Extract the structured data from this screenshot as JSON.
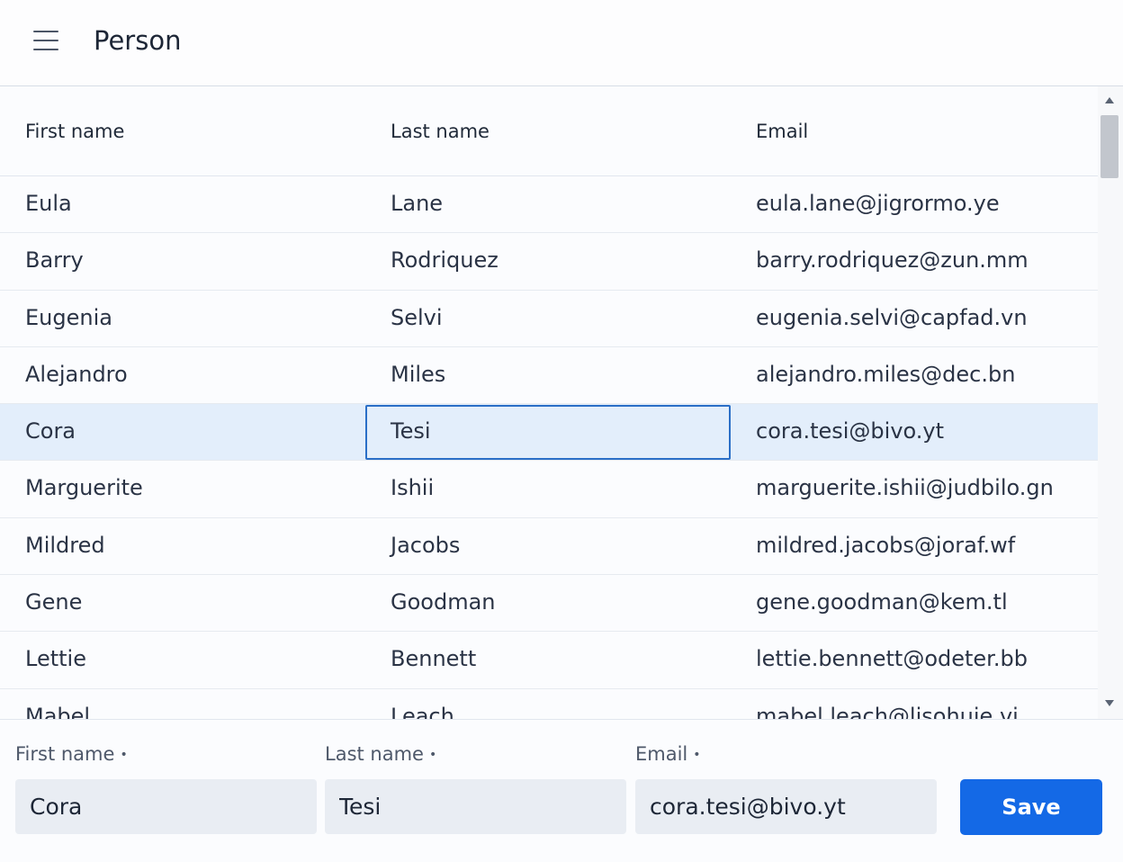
{
  "header": {
    "title": "Person",
    "menu_icon": "hamburger-menu-icon"
  },
  "grid": {
    "columns": [
      "First name",
      "Last name",
      "Email"
    ],
    "rows": [
      {
        "first": "Eula",
        "last": "Lane",
        "email": "eula.lane@jigrormo.ye"
      },
      {
        "first": "Barry",
        "last": "Rodriquez",
        "email": "barry.rodriquez@zun.mm"
      },
      {
        "first": "Eugenia",
        "last": "Selvi",
        "email": "eugenia.selvi@capfad.vn"
      },
      {
        "first": "Alejandro",
        "last": "Miles",
        "email": "alejandro.miles@dec.bn"
      },
      {
        "first": "Cora",
        "last": "Tesi",
        "email": "cora.tesi@bivo.yt"
      },
      {
        "first": "Marguerite",
        "last": "Ishii",
        "email": "marguerite.ishii@judbilo.gn"
      },
      {
        "first": "Mildred",
        "last": "Jacobs",
        "email": "mildred.jacobs@joraf.wf"
      },
      {
        "first": "Gene",
        "last": "Goodman",
        "email": "gene.goodman@kem.tl"
      },
      {
        "first": "Lettie",
        "last": "Bennett",
        "email": "lettie.bennett@odeter.bb"
      },
      {
        "first": "Mabel",
        "last": "Leach",
        "email": "mabel.leach@lisohuje.vi"
      }
    ],
    "selected_row_index": 4
  },
  "form": {
    "first_name": {
      "label": "First name",
      "value": "Cora"
    },
    "last_name": {
      "label": "Last name",
      "value": "Tesi"
    },
    "email": {
      "label": "Email",
      "value": "cora.tesi@bivo.yt"
    },
    "required_marker": "•",
    "save_label": "Save"
  },
  "colors": {
    "accent": "#1469e6",
    "selection": "#e3eefb",
    "focus": "#2b6fc7"
  }
}
